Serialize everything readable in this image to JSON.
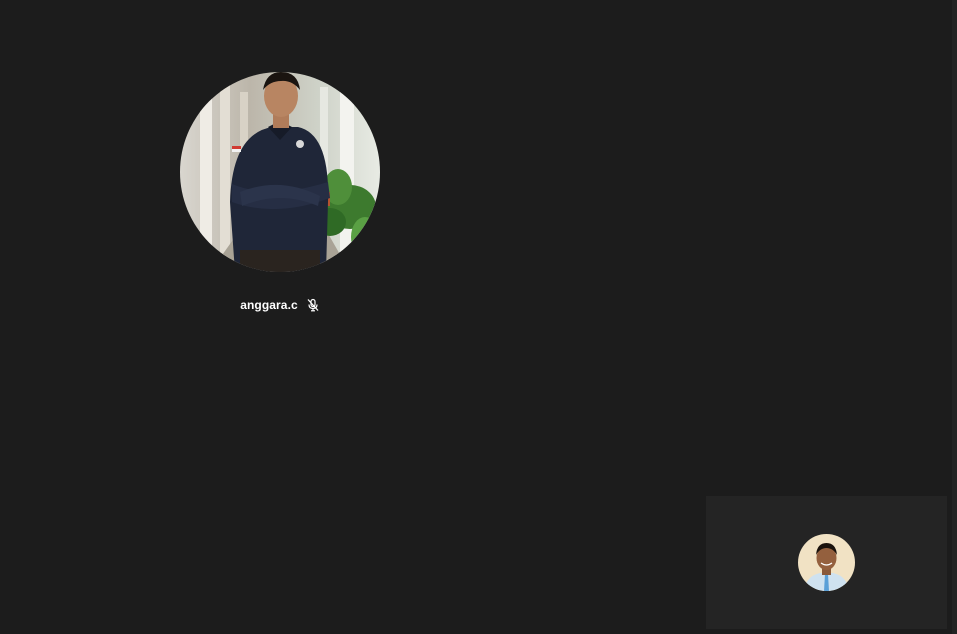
{
  "participants": [
    {
      "name": "anggara.c",
      "muted": true,
      "avatar_icon": "user-photo",
      "mute_icon": "microphone-muted-icon"
    }
  ],
  "self_view": {
    "avatar_icon": "user-photo"
  },
  "colors": {
    "background": "#1c1c1c",
    "self_tile": "#242424",
    "text": "#ffffff"
  }
}
